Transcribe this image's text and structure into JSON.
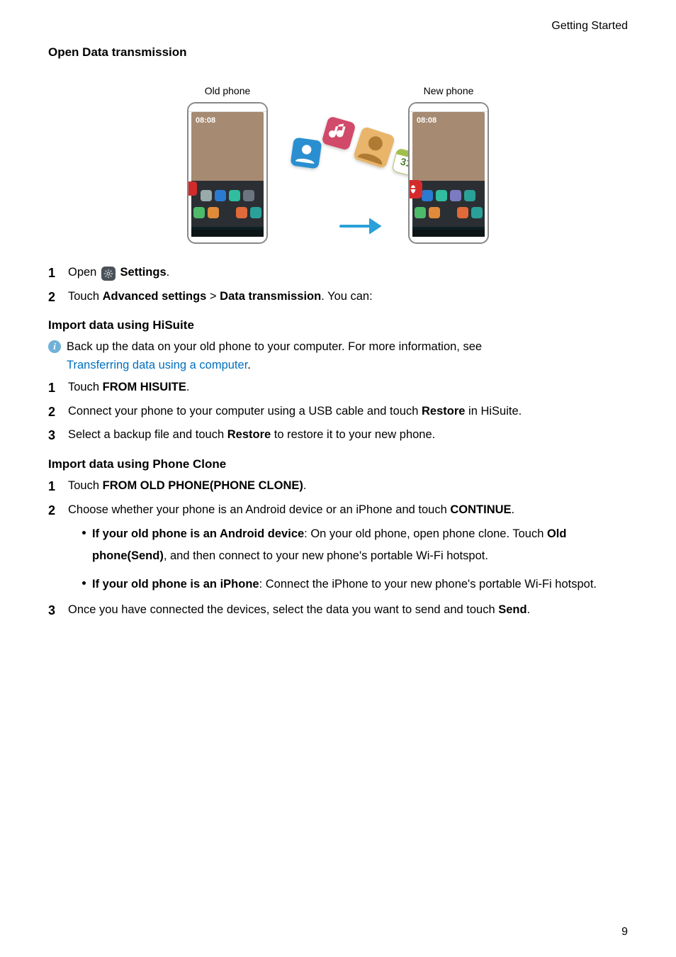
{
  "header": {
    "right": "Getting Started"
  },
  "titles": {
    "open_data": "Open Data transmission",
    "import_hisuite": "Import data using HiSuite",
    "import_clone": "Import data using Phone Clone"
  },
  "labels": {
    "old_phone": "Old phone",
    "new_phone": "New phone",
    "settings": "Settings",
    "clock": "08:08"
  },
  "steps_open": {
    "s1_prefix": "Open ",
    "s1_suffix": ".",
    "s2_a": "Touch ",
    "s2_b": "Advanced settings",
    "s2_sep": " > ",
    "s2_c": "Data transmission",
    "s2_end": ". You can:"
  },
  "info": {
    "line1": "Back up the data on your old phone to your computer. For more information, see",
    "link": "Transferring data using a computer",
    "link_end": "."
  },
  "steps_hisuite": {
    "s1_a": "Touch ",
    "s1_b": "FROM HISUITE",
    "s1_c": ".",
    "s2_a": "Connect your phone to your computer using a USB cable and touch ",
    "s2_b": "Restore",
    "s2_c": " in HiSuite.",
    "s3_a": "Select a backup file and touch ",
    "s3_b": "Restore",
    "s3_c": " to restore it to your new phone."
  },
  "steps_clone": {
    "s1_a": "Touch ",
    "s1_b": "FROM OLD PHONE(PHONE CLONE)",
    "s1_c": ".",
    "s2_a": "Choose whether your phone is an Android device or an iPhone and touch ",
    "s2_b": "CONTINUE",
    "s2_c": ".",
    "b1_a": "If your old phone is an Android device",
    "b1_b": ": On your old phone, open phone clone. Touch ",
    "b1_c": "Old phone(Send)",
    "b1_d": ", and then connect to your new phone's portable Wi-Fi hotspot.",
    "b2_a": "If your old phone is an iPhone",
    "b2_b": ": Connect the iPhone to your new phone's portable Wi-Fi hotspot.",
    "s3_a": "Once you have connected the devices, select the data you want to send and touch ",
    "s3_b": "Send",
    "s3_c": "."
  },
  "page_number": "9"
}
